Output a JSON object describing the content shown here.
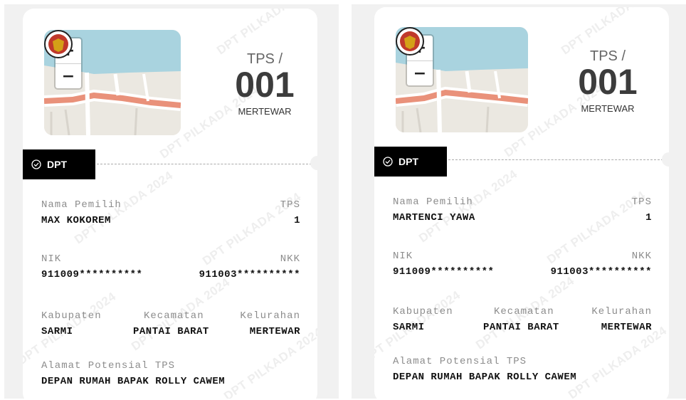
{
  "watermark": "DPT PILKADA 2024",
  "cards": [
    {
      "tps_label": "TPS /",
      "tps_number": "001",
      "tps_kelurahan": "MERTEWAR",
      "zoom_in": "+",
      "zoom_out": "−",
      "status_tag": "DPT",
      "labels": {
        "nama": "Nama Pemilih",
        "tps": "TPS",
        "nik": "NIK",
        "nkk": "NKK",
        "kabupaten": "Kabupaten",
        "kecamatan": "Kecamatan",
        "kelurahan": "Kelurahan",
        "alamat": "Alamat Potensial TPS"
      },
      "values": {
        "nama": "MAX KOKOREM",
        "tps": "1",
        "nik": "911009**********",
        "nkk": "911003**********",
        "kabupaten": "SARMI",
        "kecamatan": "PANTAI BARAT",
        "kelurahan": "MERTEWAR",
        "alamat": "DEPAN RUMAH BAPAK ROLLY CAWEM"
      }
    },
    {
      "tps_label": "TPS /",
      "tps_number": "001",
      "tps_kelurahan": "MERTEWAR",
      "zoom_in": "+",
      "zoom_out": "−",
      "status_tag": "DPT",
      "labels": {
        "nama": "Nama Pemilih",
        "tps": "TPS",
        "nik": "NIK",
        "nkk": "NKK",
        "kabupaten": "Kabupaten",
        "kecamatan": "Kecamatan",
        "kelurahan": "Kelurahan",
        "alamat": "Alamat Potensial TPS"
      },
      "values": {
        "nama": "MARTENCI YAWA",
        "tps": "1",
        "nik": "911009**********",
        "nkk": "911003**********",
        "kabupaten": "SARMI",
        "kecamatan": "PANTAI BARAT",
        "kelurahan": "MERTEWAR",
        "alamat": "DEPAN RUMAH BAPAK ROLLY CAWEM"
      }
    }
  ],
  "colors": {
    "tag_bg": "#000000",
    "map_water": "#a9d3df",
    "map_road": "#e9917a",
    "map_land": "#ebe8e1"
  }
}
